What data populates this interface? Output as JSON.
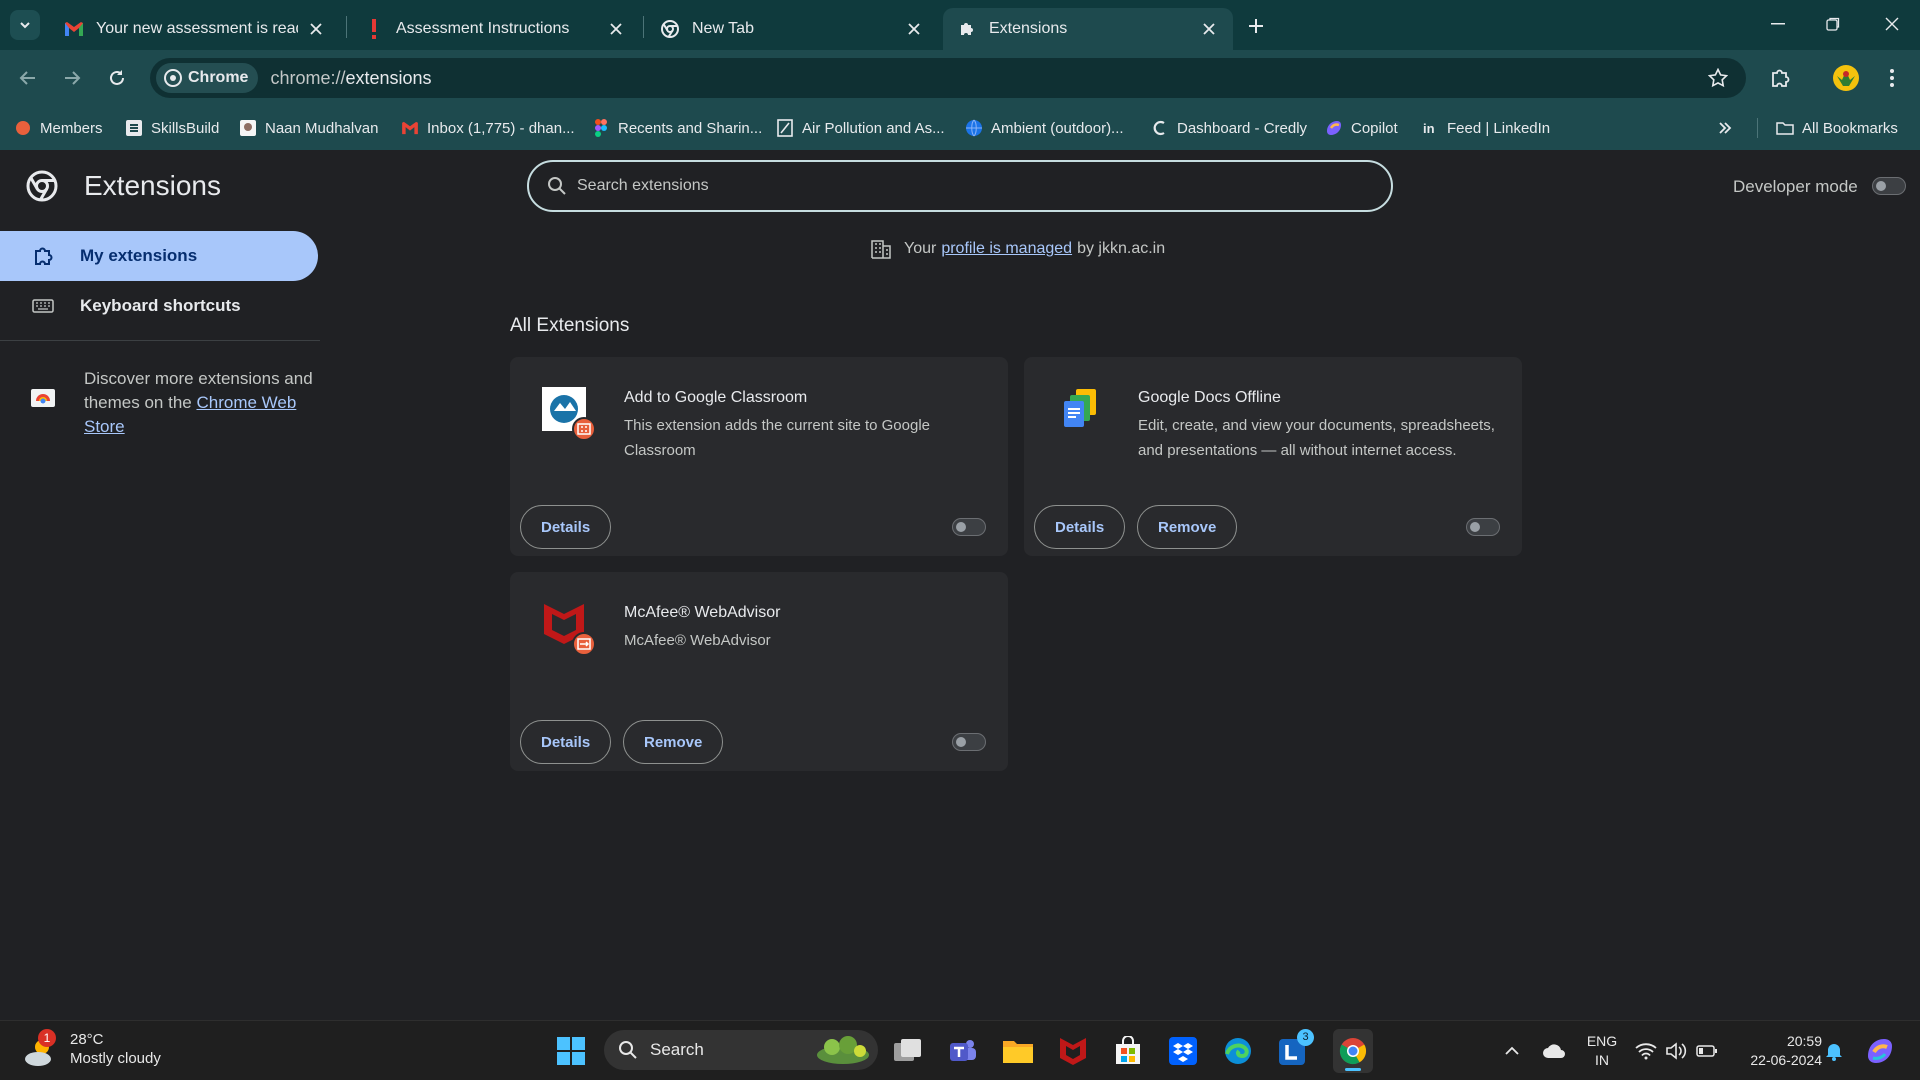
{
  "browser": {
    "tabs": [
      {
        "title": "Your new assessment is ready |",
        "icon": "gmail-icon"
      },
      {
        "title": "Assessment Instructions",
        "icon": "exclamation-icon"
      },
      {
        "title": "New Tab",
        "icon": "chrome-icon"
      },
      {
        "title": "Extensions",
        "icon": "puzzle-icon",
        "active": true
      }
    ],
    "omnibox": {
      "chip_label": "Chrome",
      "url_scheme": "chrome://",
      "url_path": "extensions"
    },
    "bookmarks": [
      {
        "label": "Members",
        "icon": "members-icon"
      },
      {
        "label": "SkillsBuild",
        "icon": "skillsbuild-icon"
      },
      {
        "label": "Naan Mudhalvan",
        "icon": "naan-mudhalvan-icon"
      },
      {
        "label": "Inbox (1,775) - dhan...",
        "icon": "gmail-icon"
      },
      {
        "label": "Recents and Sharin...",
        "icon": "figma-icon"
      },
      {
        "label": "Air Pollution and As...",
        "icon": "document-icon"
      },
      {
        "label": "Ambient (outdoor)...",
        "icon": "globe-icon"
      },
      {
        "label": "Dashboard - Credly",
        "icon": "credly-icon"
      },
      {
        "label": "Copilot",
        "icon": "copilot-icon"
      },
      {
        "label": "Feed | LinkedIn",
        "icon": "linkedin-icon"
      }
    ],
    "all_bookmarks_label": "All Bookmarks"
  },
  "page": {
    "title": "Extensions",
    "search_placeholder": "Search extensions",
    "developer_mode_label": "Developer mode",
    "nav": {
      "my_extensions": "My extensions",
      "keyboard_shortcuts": "Keyboard shortcuts"
    },
    "discover": {
      "text": "Discover more extensions and themes on the",
      "link": "Chrome Web Store"
    },
    "managed": {
      "prefix": "Your",
      "link": "profile is managed",
      "suffix": "by jkkn.ac.in"
    },
    "section_title": "All Extensions",
    "extensions": [
      {
        "name": "Add to Google Classroom",
        "description": "This extension adds the current site to Google Classroom",
        "details_label": "Details",
        "enabled": false
      },
      {
        "name": "Google Docs Offline",
        "description": "Edit, create, and view your documents, spreadsheets, and presentations — all without internet access.",
        "details_label": "Details",
        "remove_label": "Remove",
        "enabled": false
      },
      {
        "name": "McAfee® WebAdvisor",
        "description": "McAfee® WebAdvisor",
        "details_label": "Details",
        "remove_label": "Remove",
        "enabled": false
      }
    ]
  },
  "taskbar": {
    "weather": {
      "temp": "28°C",
      "condition": "Mostly cloudy",
      "badge": "1"
    },
    "search_label": "Search",
    "lang_top": "ENG",
    "lang_bottom": "IN",
    "time": "20:59",
    "date": "22-06-2024",
    "l_badge": "3"
  }
}
